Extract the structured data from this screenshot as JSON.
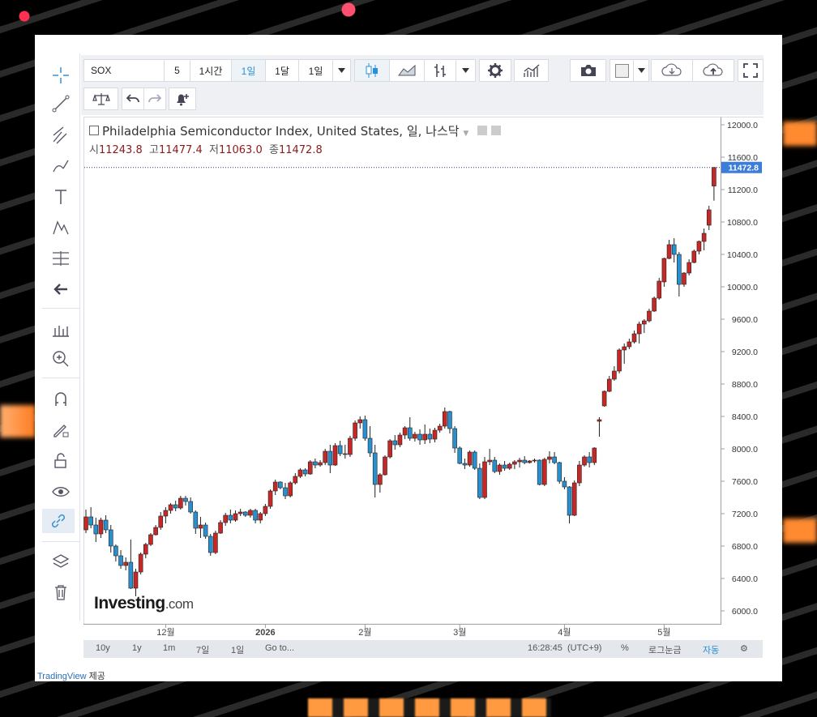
{
  "toolbar": {
    "symbol": "SOX",
    "interval_count": "5",
    "buttons": [
      "1시간",
      "1일",
      "1달",
      "1일"
    ],
    "selected_interval": "1일"
  },
  "chart_header": {
    "title": "Philadelphia Semiconductor Index, United States, 일, 나스닥",
    "open_label": "시",
    "open": "11243.8",
    "high_label": "고",
    "high": "11477.4",
    "low_label": "저",
    "low": "11063.0",
    "close_label": "종",
    "close": "11472.8"
  },
  "current_price_label": "11472.8",
  "bottom_bar": {
    "ranges": [
      "10y",
      "1y",
      "1m",
      "7일",
      "1일"
    ],
    "goto": "Go to...",
    "time": "16:28:45",
    "tz": "(UTC+9)",
    "percent": "%",
    "log": "로그눈금",
    "auto": "자동"
  },
  "logo": {
    "main": "Investing",
    "suffix": ".com"
  },
  "credit": {
    "provider": "TradingView",
    "suffix": "제공"
  },
  "chart_data": {
    "type": "candlestick",
    "title": "Philadelphia Semiconductor Index, United States, 일, 나스닥",
    "y_ticks": [
      12000,
      11600,
      11200,
      10800,
      10400,
      10000,
      9600,
      9200,
      8800,
      8400,
      8000,
      7600,
      7200,
      6800,
      6400,
      6000
    ],
    "ylim": [
      5850,
      12100
    ],
    "x_ticks": [
      {
        "label": "12월",
        "i": 16
      },
      {
        "label": "2026",
        "i": 36
      },
      {
        "label": "2월",
        "i": 56
      },
      {
        "label": "3월",
        "i": 75
      },
      {
        "label": "4월",
        "i": 96
      },
      {
        "label": "5월",
        "i": 116
      }
    ],
    "colors": {
      "up": "#c62828",
      "down": "#2a8fcf",
      "price_line": "#2c3e6b"
    },
    "candles": [
      [
        7000,
        7250,
        6960,
        7160
      ],
      [
        7160,
        7280,
        7020,
        7060
      ],
      [
        7060,
        7150,
        6850,
        6950
      ],
      [
        6950,
        7150,
        6900,
        7120
      ],
      [
        7120,
        7180,
        6960,
        7000
      ],
      [
        7000,
        7060,
        6720,
        6800
      ],
      [
        6800,
        6820,
        6610,
        6680
      ],
      [
        6680,
        6750,
        6520,
        6560
      ],
      [
        6560,
        6660,
        6500,
        6600
      ],
      [
        6600,
        6880,
        6270,
        6280
      ],
      [
        6280,
        6520,
        6180,
        6480
      ],
      [
        6480,
        6720,
        6450,
        6700
      ],
      [
        6700,
        6840,
        6650,
        6820
      ],
      [
        6820,
        6960,
        6800,
        6940
      ],
      [
        6940,
        7060,
        6930,
        7030
      ],
      [
        7030,
        7220,
        7000,
        7170
      ],
      [
        7170,
        7280,
        7080,
        7240
      ],
      [
        7240,
        7330,
        7200,
        7310
      ],
      [
        7310,
        7360,
        7230,
        7270
      ],
      [
        7270,
        7420,
        7250,
        7390
      ],
      [
        7390,
        7420,
        7300,
        7350
      ],
      [
        7350,
        7400,
        7200,
        7220
      ],
      [
        7220,
        7240,
        6950,
        7020
      ],
      [
        7020,
        7160,
        6900,
        7060
      ],
      [
        7060,
        7090,
        6890,
        6920
      ],
      [
        6920,
        6950,
        6680,
        6720
      ],
      [
        6720,
        6990,
        6700,
        6960
      ],
      [
        6960,
        7120,
        6950,
        7090
      ],
      [
        7090,
        7210,
        7050,
        7180
      ],
      [
        7180,
        7250,
        7080,
        7120
      ],
      [
        7120,
        7240,
        7100,
        7200
      ],
      [
        7200,
        7260,
        7170,
        7220
      ],
      [
        7220,
        7230,
        7160,
        7180
      ],
      [
        7180,
        7260,
        7150,
        7240
      ],
      [
        7240,
        7260,
        7080,
        7120
      ],
      [
        7120,
        7220,
        7080,
        7200
      ],
      [
        7200,
        7320,
        7170,
        7290
      ],
      [
        7290,
        7500,
        7260,
        7480
      ],
      [
        7480,
        7620,
        7430,
        7590
      ],
      [
        7590,
        7600,
        7500,
        7520
      ],
      [
        7520,
        7580,
        7380,
        7420
      ],
      [
        7420,
        7600,
        7400,
        7580
      ],
      [
        7580,
        7700,
        7560,
        7660
      ],
      [
        7660,
        7760,
        7640,
        7740
      ],
      [
        7740,
        7760,
        7660,
        7690
      ],
      [
        7690,
        7860,
        7680,
        7840
      ],
      [
        7840,
        7880,
        7760,
        7800
      ],
      [
        7800,
        7860,
        7780,
        7830
      ],
      [
        7830,
        8000,
        7800,
        7970
      ],
      [
        7970,
        8050,
        7700,
        7800
      ],
      [
        7800,
        8070,
        7790,
        8040
      ],
      [
        8040,
        8100,
        7910,
        7940
      ],
      [
        7940,
        8050,
        7880,
        7930
      ],
      [
        7930,
        8160,
        7900,
        8130
      ],
      [
        8130,
        8350,
        8100,
        8320
      ],
      [
        8320,
        8400,
        8250,
        8360
      ],
      [
        8360,
        8410,
        8100,
        8130
      ],
      [
        8130,
        8280,
        7900,
        7950
      ],
      [
        7950,
        8050,
        7400,
        7560
      ],
      [
        7560,
        7700,
        7460,
        7680
      ],
      [
        7680,
        7920,
        7670,
        7900
      ],
      [
        7900,
        8120,
        7880,
        8100
      ],
      [
        8100,
        8170,
        7990,
        8050
      ],
      [
        8050,
        8200,
        8020,
        8170
      ],
      [
        8170,
        8280,
        8120,
        8260
      ],
      [
        8260,
        8390,
        8100,
        8130
      ],
      [
        8130,
        8210,
        8090,
        8180
      ],
      [
        8180,
        8240,
        8050,
        8110
      ],
      [
        8110,
        8300,
        8060,
        8180
      ],
      [
        8180,
        8250,
        8070,
        8120
      ],
      [
        8120,
        8260,
        8080,
        8230
      ],
      [
        8230,
        8310,
        8200,
        8280
      ],
      [
        8280,
        8510,
        8250,
        8460
      ],
      [
        8460,
        8470,
        8190,
        8250
      ],
      [
        8250,
        8280,
        7950,
        8010
      ],
      [
        8010,
        8030,
        7810,
        7820
      ],
      [
        7820,
        7880,
        7750,
        7800
      ],
      [
        7800,
        7980,
        7780,
        7960
      ],
      [
        7960,
        7980,
        7740,
        7760
      ],
      [
        7760,
        7820,
        7380,
        7400
      ],
      [
        7400,
        7900,
        7380,
        7840
      ],
      [
        7840,
        8000,
        7800,
        7860
      ],
      [
        7860,
        7900,
        7700,
        7720
      ],
      [
        7720,
        7820,
        7680,
        7800
      ],
      [
        7800,
        7850,
        7730,
        7760
      ],
      [
        7760,
        7830,
        7740,
        7810
      ],
      [
        7810,
        7860,
        7750,
        7840
      ],
      [
        7840,
        7890,
        7770,
        7860
      ],
      [
        7860,
        7910,
        7810,
        7830
      ],
      [
        7830,
        7860,
        7820,
        7850
      ],
      [
        7850,
        7880,
        7830,
        7860
      ],
      [
        7860,
        7870,
        7550,
        7560
      ],
      [
        7560,
        7890,
        7540,
        7870
      ],
      [
        7870,
        7970,
        7820,
        7900
      ],
      [
        7900,
        7960,
        7810,
        7830
      ],
      [
        7830,
        7840,
        7570,
        7600
      ],
      [
        7600,
        7650,
        7500,
        7530
      ],
      [
        7530,
        7540,
        7080,
        7180
      ],
      [
        7180,
        7610,
        7170,
        7580
      ],
      [
        7580,
        7850,
        7540,
        7800
      ],
      [
        7800,
        7920,
        7780,
        7900
      ],
      [
        7900,
        7960,
        7770,
        7830
      ],
      [
        7830,
        8020,
        7800,
        8010
      ],
      [
        8340,
        8390,
        8150,
        8360
      ],
      [
        8530,
        8720,
        8520,
        8710
      ],
      [
        8710,
        8900,
        8700,
        8860
      ],
      [
        8860,
        9020,
        8840,
        8960
      ],
      [
        8960,
        9240,
        8930,
        9220
      ],
      [
        9220,
        9300,
        9050,
        9260
      ],
      [
        9260,
        9360,
        9230,
        9320
      ],
      [
        9320,
        9460,
        9300,
        9420
      ],
      [
        9420,
        9570,
        9300,
        9540
      ],
      [
        9540,
        9600,
        9430,
        9580
      ],
      [
        9580,
        9730,
        9560,
        9700
      ],
      [
        9700,
        9880,
        9690,
        9860
      ],
      [
        9860,
        10110,
        9840,
        10070
      ],
      [
        10060,
        10360,
        10000,
        10350
      ],
      [
        10350,
        10580,
        10340,
        10520
      ],
      [
        10520,
        10600,
        10300,
        10400
      ],
      [
        10400,
        10430,
        9880,
        10030
      ],
      [
        10030,
        10180,
        10000,
        10170
      ],
      [
        10170,
        10340,
        10140,
        10300
      ],
      [
        10300,
        10460,
        10290,
        10440
      ],
      [
        10440,
        10570,
        10400,
        10560
      ],
      [
        10560,
        10720,
        10450,
        10660
      ],
      [
        10760,
        11000,
        10700,
        10950
      ],
      [
        11243.8,
        11477.4,
        11063.0,
        11472.8
      ]
    ]
  }
}
